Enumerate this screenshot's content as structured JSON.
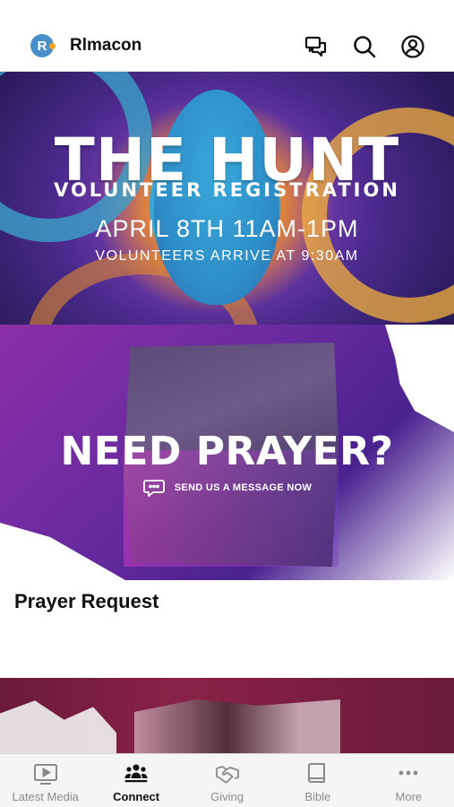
{
  "header": {
    "logo_letter": "R",
    "app_title": "Rlmacon"
  },
  "banners": {
    "hunt": {
      "title": "THE HUNT",
      "subtitle": "VOLUNTEER REGISTRATION",
      "date_time": "APRIL 8TH 11AM-1PM",
      "arrival": "VOLUNTEERS ARRIVE AT 9:30AM"
    },
    "prayer": {
      "title": "NEED PRAYER?",
      "cta": "SEND US A MESSAGE NOW"
    }
  },
  "cards": [
    {
      "title": "Prayer Request"
    }
  ],
  "tabbar": {
    "tabs": [
      {
        "label": "Latest Media",
        "icon": "play-icon",
        "active": false
      },
      {
        "label": "Connect",
        "icon": "group-icon",
        "active": true
      },
      {
        "label": "Giving",
        "icon": "handshake-icon",
        "active": false
      },
      {
        "label": "Bible",
        "icon": "book-icon",
        "active": false
      },
      {
        "label": "More",
        "icon": "more-icon",
        "active": false
      }
    ]
  },
  "colors": {
    "active_tab": "#111111",
    "inactive_tab": "#8a8a8a",
    "logo_blue": "#4a90c8",
    "logo_accent": "#f1a21b"
  }
}
